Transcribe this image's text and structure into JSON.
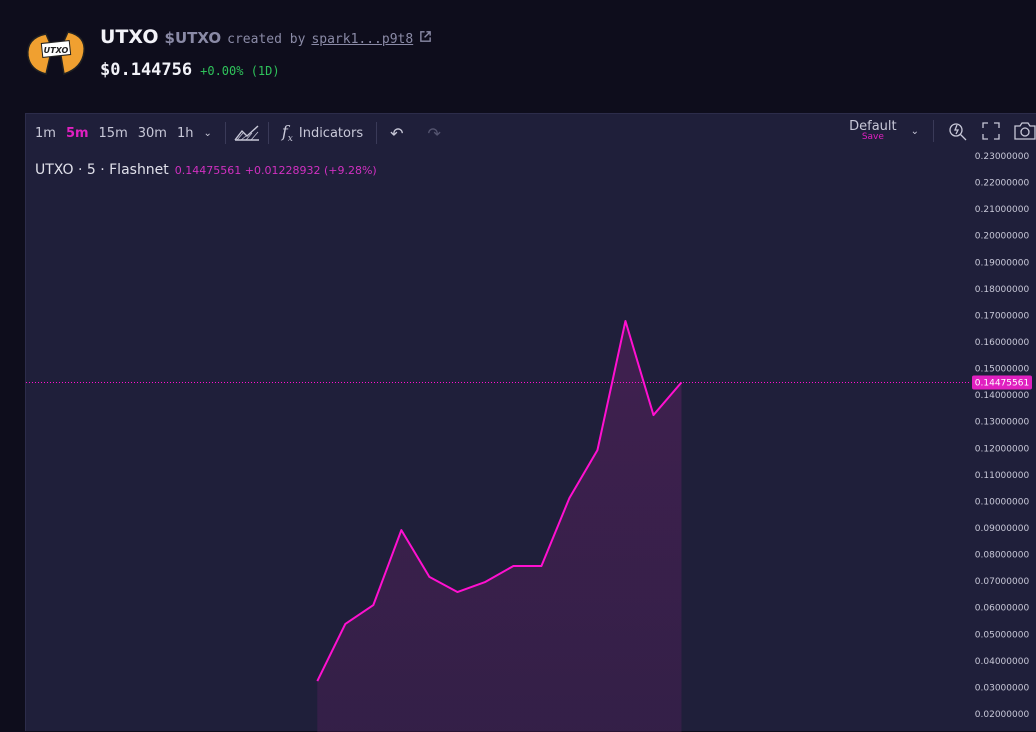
{
  "token": {
    "name": "UTXO",
    "symbol": "$UTXO",
    "created_by_label": "created by",
    "creator": "spark1...p9t8",
    "logo_text": "UTXO",
    "price": "$0.144756",
    "change": "+0.00% (1D)"
  },
  "toolbar": {
    "intervals": [
      "1m",
      "5m",
      "15m",
      "30m",
      "1h"
    ],
    "active_interval": "5m",
    "indicators_label": "Indicators",
    "layout_label": "Default",
    "save_label": "Save"
  },
  "legend": {
    "title": "UTXO · 5 · Flashnet",
    "values": "0.14475561 +0.01228932 (+9.28%)"
  },
  "colors": {
    "line": "#ff10d0",
    "accent": "#e020c0",
    "up": "#2fc25b"
  },
  "chart_data": {
    "type": "area",
    "x": [
      0,
      1,
      2,
      3,
      4,
      5,
      6,
      7,
      8,
      9,
      10,
      11,
      12,
      13
    ],
    "values": [
      0.0324,
      0.0539,
      0.061,
      0.0892,
      0.0716,
      0.0659,
      0.0697,
      0.0757,
      0.0757,
      0.1013,
      0.1193,
      0.1679,
      0.1325,
      0.1448
    ],
    "ylim": [
      0.015,
      0.235
    ],
    "xlim": [
      -10.4,
      23.3
    ],
    "yticks": [
      "0.23000000",
      "0.22000000",
      "0.21000000",
      "0.20000000",
      "0.19000000",
      "0.18000000",
      "0.17000000",
      "0.16000000",
      "0.15000000",
      "0.14000000",
      "0.13000000",
      "0.12000000",
      "0.11000000",
      "0.10000000",
      "0.09000000",
      "0.08000000",
      "0.07000000",
      "0.06000000",
      "0.05000000",
      "0.04000000",
      "0.03000000",
      "0.02000000"
    ],
    "last_price_label": "0.14475561",
    "last_price": 0.14475561
  }
}
